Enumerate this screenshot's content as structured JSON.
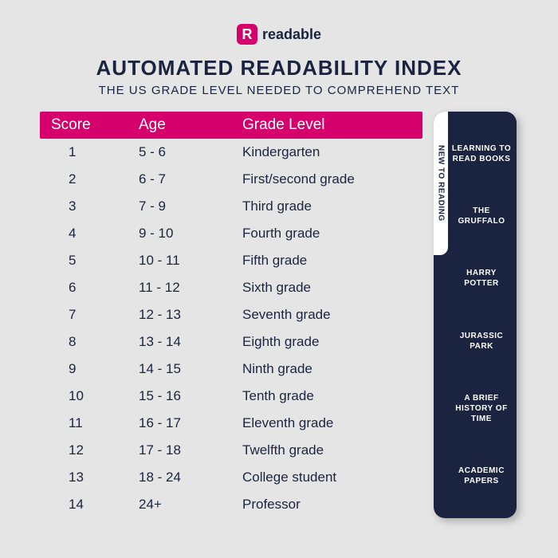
{
  "brand": {
    "mark": "R",
    "name": "readable"
  },
  "title": "AUTOMATED READABILITY INDEX",
  "subtitle": "THE US GRADE LEVEL NEEDED TO COMPREHEND TEXT",
  "columns": {
    "score": "Score",
    "age": "Age",
    "grade": "Grade Level"
  },
  "rows": [
    {
      "score": "1",
      "age": "5 - 6",
      "grade": "Kindergarten"
    },
    {
      "score": "2",
      "age": "6 - 7",
      "grade": "First/second grade"
    },
    {
      "score": "3",
      "age": "7 - 9",
      "grade": "Third grade"
    },
    {
      "score": "4",
      "age": "9 - 10",
      "grade": "Fourth grade"
    },
    {
      "score": "5",
      "age": "10 - 11",
      "grade": "Fifth grade"
    },
    {
      "score": "6",
      "age": "11 - 12",
      "grade": "Sixth grade"
    },
    {
      "score": "7",
      "age": "12 - 13",
      "grade": "Seventh grade"
    },
    {
      "score": "8",
      "age": "13 - 14",
      "grade": "Eighth grade"
    },
    {
      "score": "9",
      "age": "14 - 15",
      "grade": "Ninth grade"
    },
    {
      "score": "10",
      "age": "15 - 16",
      "grade": "Tenth grade"
    },
    {
      "score": "11",
      "age": "16 - 17",
      "grade": "Eleventh grade"
    },
    {
      "score": "12",
      "age": "17 - 18",
      "grade": "Twelfth grade"
    },
    {
      "score": "13",
      "age": "18 - 24",
      "grade": "College student"
    },
    {
      "score": "14",
      "age": "24+",
      "grade": "Professor"
    }
  ],
  "side": {
    "strip": "NEW TO READING",
    "items": [
      "LEARNING TO READ BOOKS",
      "THE GRUFFALO",
      "HARRY POTTER",
      "JURASSIC PARK",
      "A BRIEF HISTORY OF TIME",
      "ACADEMIC PAPERS"
    ]
  },
  "chart_data": {
    "type": "table",
    "title": "Automated Readability Index",
    "columns": [
      "Score",
      "Age",
      "Grade Level"
    ],
    "rows": [
      [
        1,
        "5-6",
        "Kindergarten"
      ],
      [
        2,
        "6-7",
        "First/second grade"
      ],
      [
        3,
        "7-9",
        "Third grade"
      ],
      [
        4,
        "9-10",
        "Fourth grade"
      ],
      [
        5,
        "10-11",
        "Fifth grade"
      ],
      [
        6,
        "11-12",
        "Sixth grade"
      ],
      [
        7,
        "12-13",
        "Seventh grade"
      ],
      [
        8,
        "13-14",
        "Eighth grade"
      ],
      [
        9,
        "14-15",
        "Ninth grade"
      ],
      [
        10,
        "15-16",
        "Tenth grade"
      ],
      [
        11,
        "16-17",
        "Eleventh grade"
      ],
      [
        12,
        "17-18",
        "Twelfth grade"
      ],
      [
        13,
        "18-24",
        "College student"
      ],
      [
        14,
        "24+",
        "Professor"
      ]
    ],
    "examples": [
      "Learning to read books",
      "The Gruffalo",
      "Harry Potter",
      "Jurassic Park",
      "A Brief History of Time",
      "Academic Papers"
    ]
  }
}
